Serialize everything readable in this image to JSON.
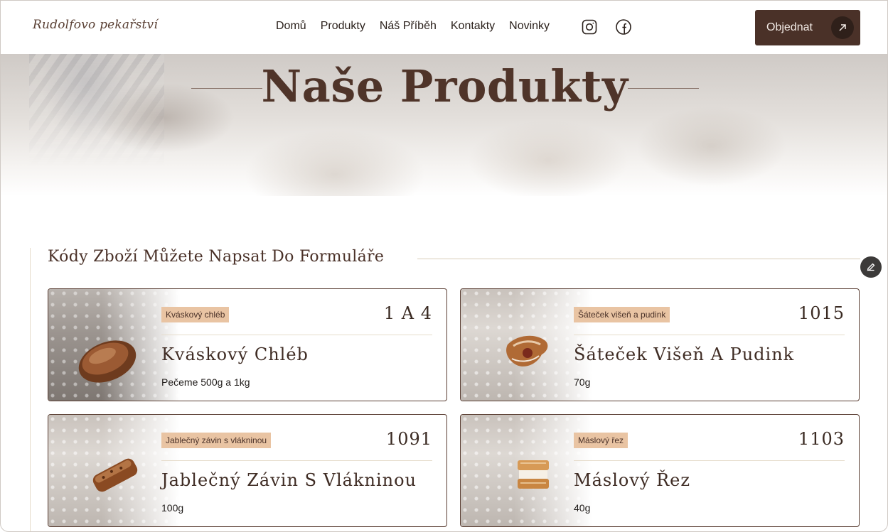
{
  "header": {
    "logo": "Rudolfovo pekařství",
    "nav": [
      "Domů",
      "Produkty",
      "Náš Příběh",
      "Kontakty",
      "Novinky"
    ],
    "social_icons": [
      "instagram-icon",
      "facebook-icon"
    ],
    "order_label": "Objednat"
  },
  "hero": {
    "title": "Naše Produkty"
  },
  "section": {
    "title": "Kódy Zboží Můžete Napsat Do Formuláře"
  },
  "products": [
    {
      "tag": "Kváskový chléb",
      "code": "1 A 4",
      "name": "Kváskový Chléb",
      "weight": "Pečeme 500g a 1kg"
    },
    {
      "tag": "Šáteček višeň a pudink",
      "code": "1015",
      "name": "Šáteček Višeň A Pudink",
      "weight": "70g"
    },
    {
      "tag": "Jablečný závin s vlákninou",
      "code": "1091",
      "name": "Jablečný Závin S Vlákninou",
      "weight": "100g"
    },
    {
      "tag": "Máslový řez",
      "code": "1103",
      "name": "Máslový Řez",
      "weight": "40g"
    }
  ],
  "colors": {
    "brand": "#4a3128",
    "tag_bg": "#e9c4a3",
    "accent_line": "#d9ccb8"
  }
}
